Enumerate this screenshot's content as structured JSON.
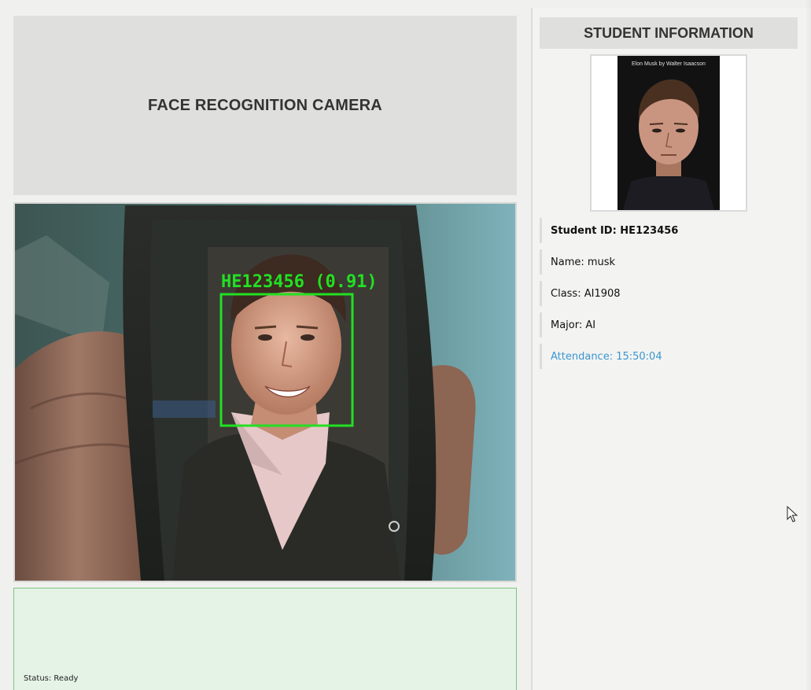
{
  "camera": {
    "title": "FACE RECOGNITION CAMERA",
    "detection_label": "HE123456 (0.91)"
  },
  "status": {
    "text": "Status: Ready"
  },
  "student": {
    "header": "STUDENT INFORMATION",
    "photo_caption": "Elon Musk by Walter Isaacson",
    "id": "Student ID: HE123456",
    "name": "Name: musk",
    "class": "Class: AI1908",
    "major": "Major: AI",
    "attendance": "Attendance: 15:50:04"
  },
  "colors": {
    "detection_box": "#22e022",
    "attendance_text": "#3a96d0",
    "status_panel_bg": "#e5f2e6"
  }
}
